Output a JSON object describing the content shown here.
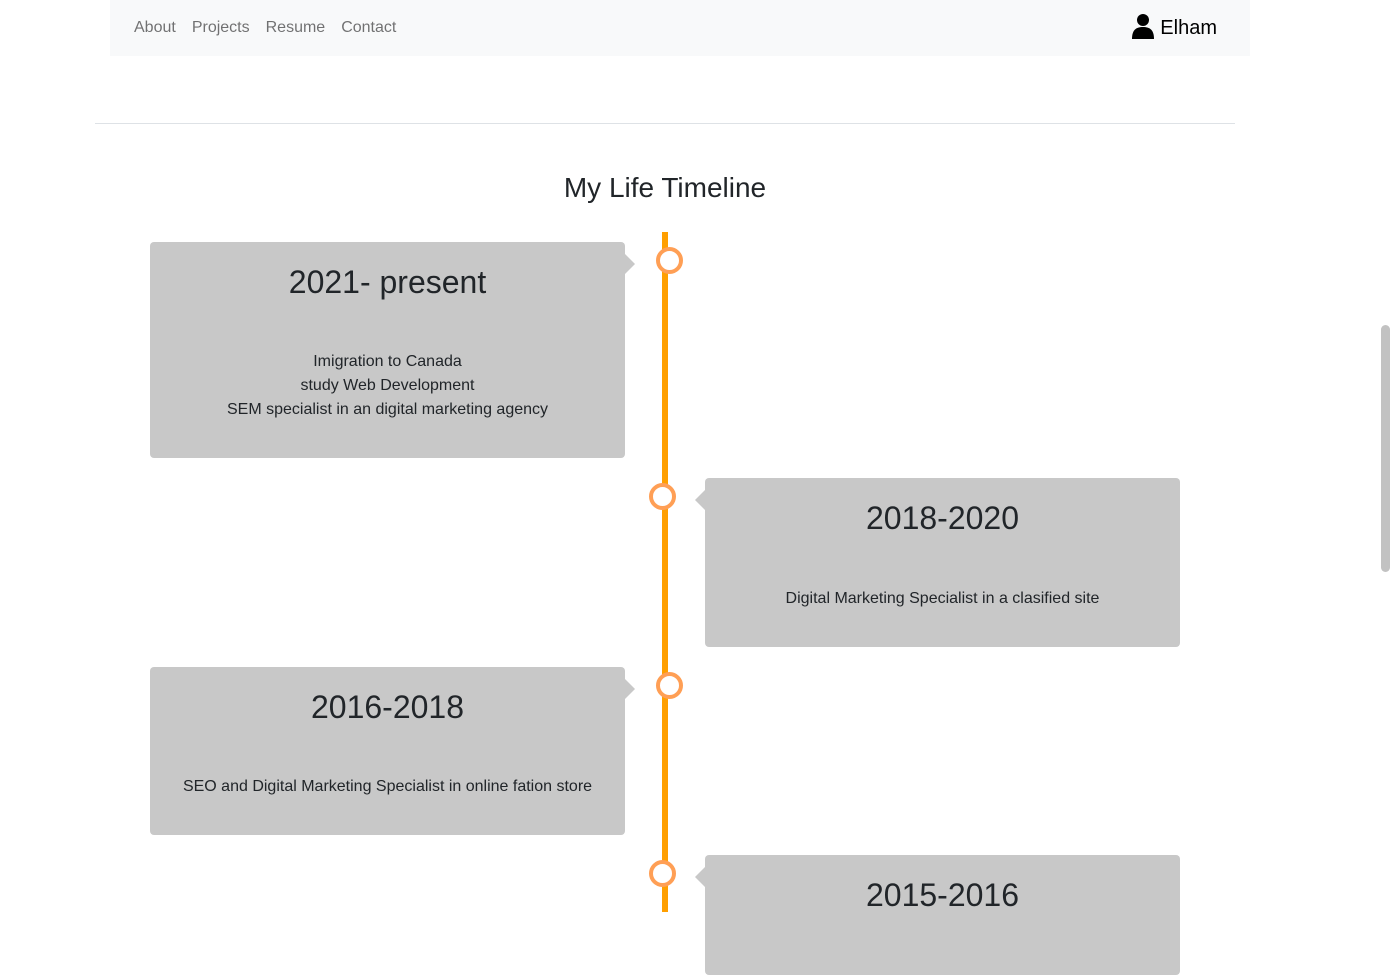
{
  "navbar": {
    "links": [
      {
        "label": "About"
      },
      {
        "label": "Projects"
      },
      {
        "label": "Resume"
      },
      {
        "label": "Contact"
      }
    ],
    "brand": {
      "label": "Elham",
      "icon": "user-icon"
    }
  },
  "timeline": {
    "title": "My Life Timeline",
    "accent_color": "#ff9f00",
    "card_color": "#c8c8c8",
    "entries": [
      {
        "period": "2021- present",
        "lines": [
          "Imigration to Canada",
          "study Web Development",
          "SEM specialist in an digital marketing agency"
        ]
      },
      {
        "period": "2018-2020",
        "lines": [
          "Digital Marketing Specialist in a clasified site"
        ]
      },
      {
        "period": "2016-2018",
        "lines": [
          "SEO and Digital Marketing Specialist in online fation store"
        ]
      },
      {
        "period": "2015-2016",
        "lines": []
      }
    ]
  }
}
